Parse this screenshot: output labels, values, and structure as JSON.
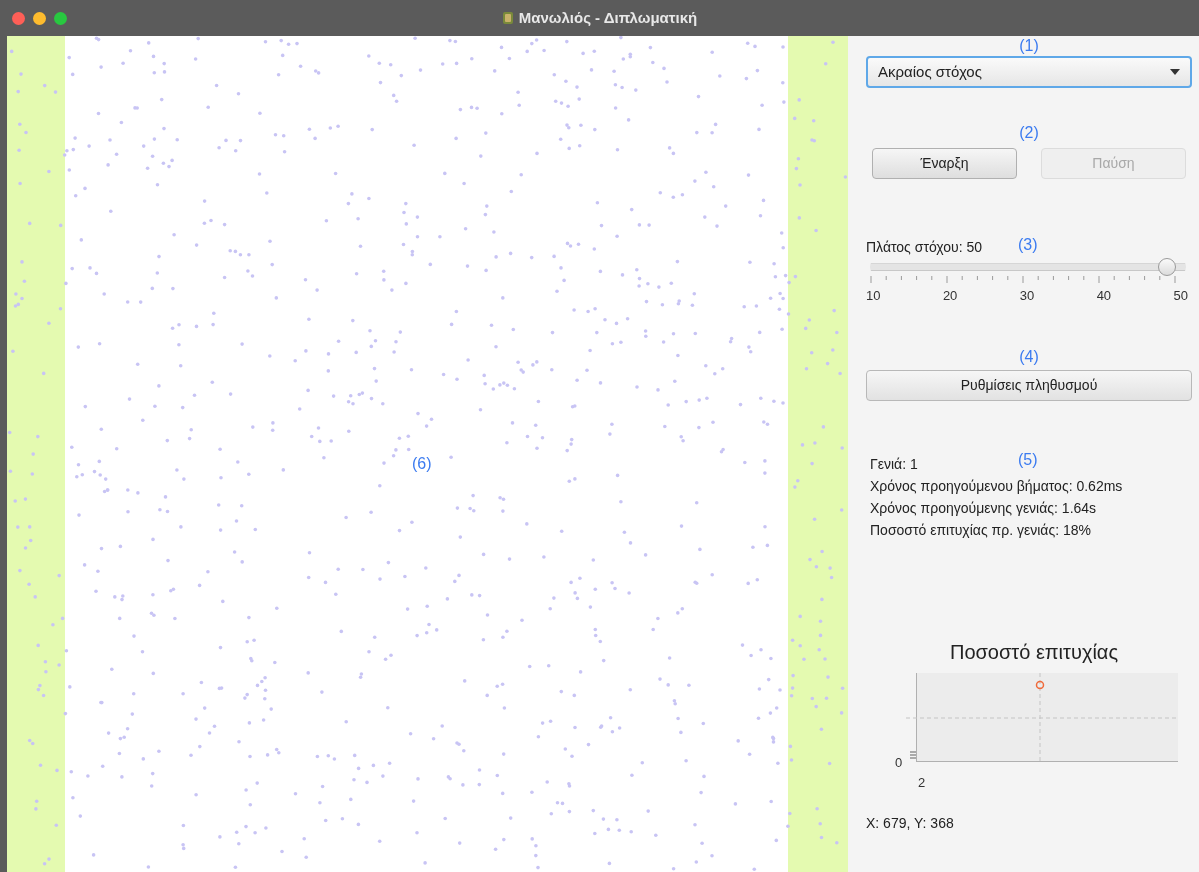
{
  "window": {
    "title": "Μανωλιός - Διπλωματική"
  },
  "canvas": {
    "annotation": "(6)"
  },
  "annotations": [
    "(1)",
    "(2)",
    "(3)",
    "(4)",
    "(5)"
  ],
  "dropdown": {
    "value": "Ακραίος στόχος",
    "focused": true
  },
  "buttons": [
    {
      "label": "Έναρξη",
      "disabled": false
    },
    {
      "label": "Παύση",
      "disabled": true
    }
  ],
  "slider": {
    "label": "Πλάτος στόχου: 50",
    "level": 1,
    "tick_labels": [
      "10",
      "20",
      "30",
      "40",
      "50"
    ]
  },
  "settings_button": {
    "label": "Ρυθμίσεις πληθυσμού"
  },
  "stats": [
    "Γενιά: 1",
    "Χρόνος προηγούμενου βήματος: 0.62ms",
    "Χρόνος προηγούμενης γενιάς: 1.64s",
    "Ποσοστό επιτυχίας πρ. γενιάς: 18%"
  ],
  "chart": {
    "title": "Ποσοστό επιτυχίας",
    "y_tick": "0",
    "x_tick": "2"
  },
  "coordinates": "X: 679, Y: 368"
}
